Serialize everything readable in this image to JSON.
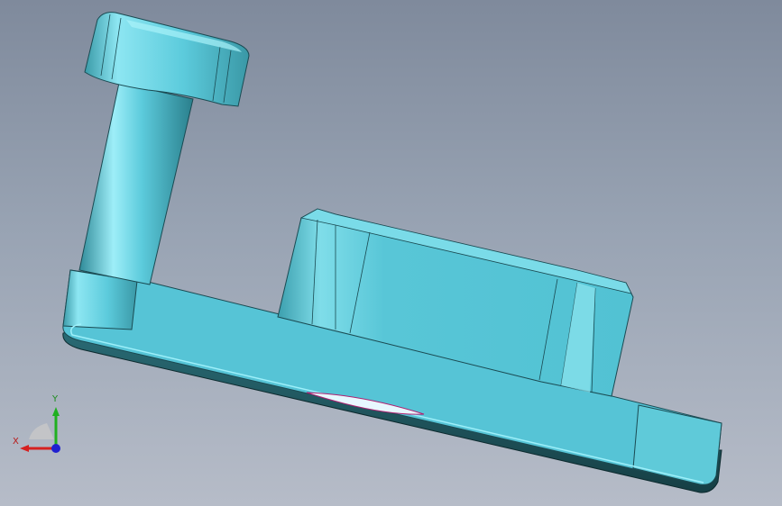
{
  "viewport": {
    "background_top": "#7f8a9c",
    "background_bottom": "#b6bcc8"
  },
  "model": {
    "color": "#56c4d6",
    "shadow_color": "#1e4f57",
    "parts": [
      "bracket-plate",
      "mounting-boss",
      "post-cylinder",
      "post-cap"
    ]
  },
  "triad": {
    "x_label": "X",
    "y_label": "Y",
    "x_color": "#d62020",
    "y_color": "#20b020",
    "z_color": "#2020d0"
  }
}
